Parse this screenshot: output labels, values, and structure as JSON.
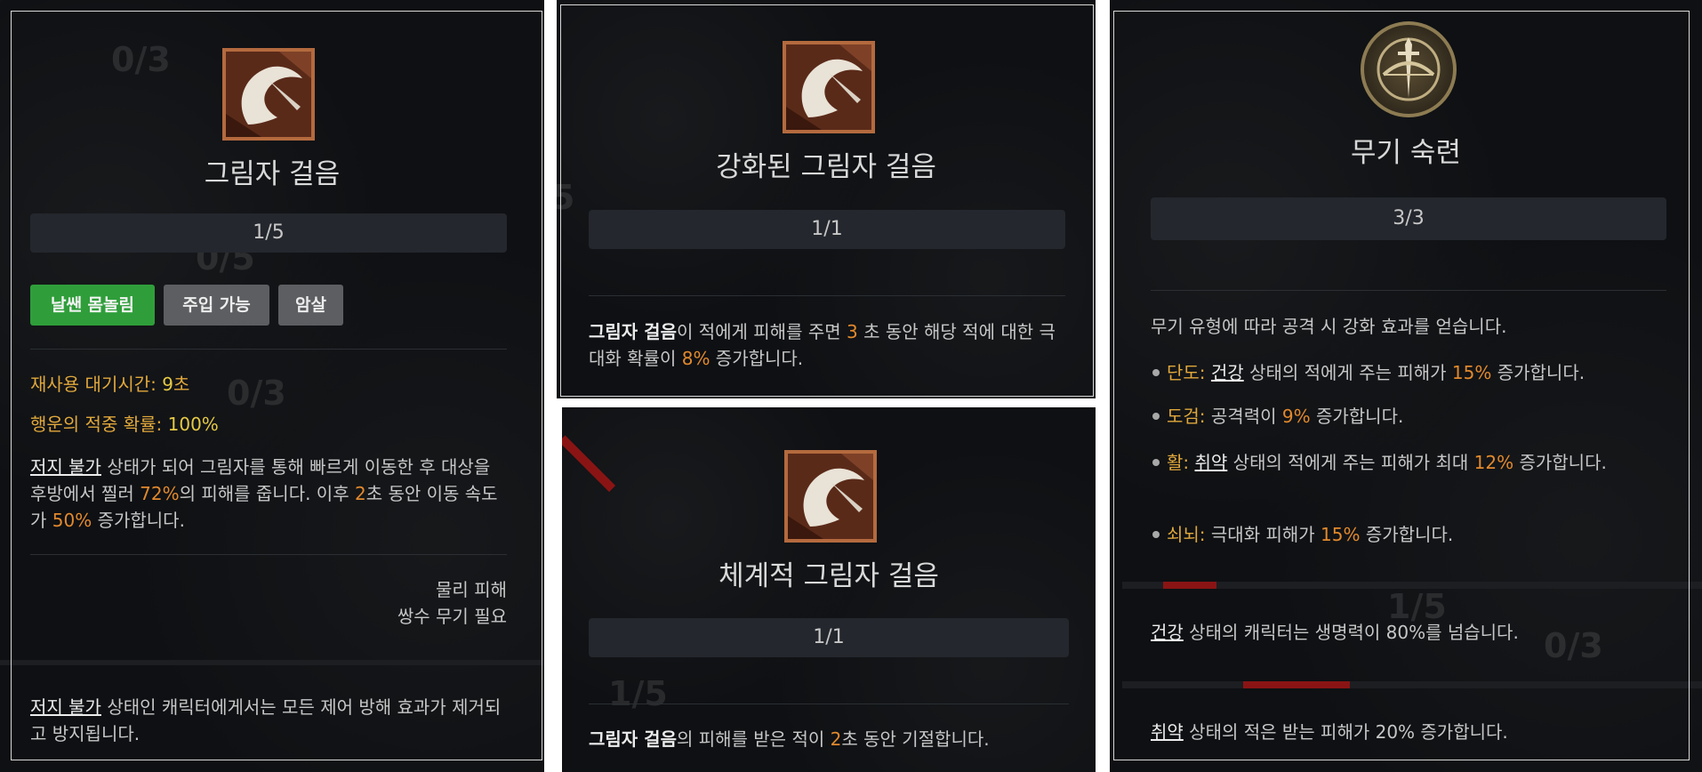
{
  "panel1": {
    "ghost_counts": [
      "0/3",
      "0/5",
      "0/3"
    ],
    "icon": "shadow-step-blade-icon",
    "title": "그림자 걸음",
    "rank": "1/5",
    "tags": [
      "날쌘 몸놀림",
      "주입 가능",
      "암살"
    ],
    "cooldown_label": "재사용 대기시간:",
    "cooldown_value": "9",
    "cooldown_unit": "초",
    "lucky_label": "행운의 적중 확률:",
    "lucky_value": "100%",
    "desc_term": "저지 불가",
    "desc_part1": " 상태가 되어 그림자를 통해 빠르게 이동한 후 대상을 후방에서 찔러 ",
    "desc_damage": "72%",
    "desc_part2": "의 피해를 줍니다. 이후 ",
    "desc_duration": "2",
    "desc_part3": "초 동안 이동 속도가 ",
    "desc_speed": "50%",
    "desc_part4": " 증가합니다.",
    "damage_type": "물리 피해",
    "requirement": "쌍수 무기 필요",
    "note_term": "저지 불가",
    "note_text": " 상태인 캐릭터에게서는 모든 제어 방해 효과가 제거되고 방지됩니다."
  },
  "panel2": {
    "icon": "shadow-step-blade-icon",
    "title": "강화된 그림자 걸음",
    "rank": "1/1",
    "desc_term": "그림자 걸음",
    "desc_part1": "이 적에게 피해를 주면 ",
    "desc_seconds": "3",
    "desc_part2": " 초 동안 해당 적에 대한 극대화 확률이 ",
    "desc_percent": "8%",
    "desc_part3": " 증가합니다."
  },
  "panel3": {
    "icon": "shadow-step-blade-icon",
    "title": "체계적 그림자 걸음",
    "rank": "1/1",
    "ghost_count": "1/5",
    "desc_term": "그림자 걸음",
    "desc_part1": "의 피해를 받은 적이 ",
    "desc_seconds": "2",
    "desc_part2": "초 동안 기절합니다."
  },
  "panel4": {
    "icon": "sword-crossbow-emblem-icon",
    "title": "무기 숙련",
    "rank": "3/3",
    "intro": "무기 유형에 따라 공격 시 강화 효과를 얻습니다.",
    "bullets": [
      {
        "weapon": "단도:",
        "term": "건강",
        "text1": " 상태의 적에게 주는 피해가 ",
        "value": "15%",
        "text2": " 증가합니다."
      },
      {
        "weapon": "도검:",
        "term": "",
        "text1": " 공격력이 ",
        "value": "9%",
        "text2": " 증가합니다."
      },
      {
        "weapon": "활:",
        "term": "취약",
        "text1": " 상태의 적에게 주는 피해가 최대 ",
        "value": "12%",
        "text2": " 증가합니다."
      },
      {
        "weapon": "쇠뇌:",
        "term": "",
        "text1": " 극대화 피해가 ",
        "value": "15%",
        "text2": " 증가합니다."
      }
    ],
    "ghost_counts": [
      "1/5",
      "0/3"
    ],
    "note1_term": "건강",
    "note1_text": " 상태의 캐릭터는 생명력이 80%를 넘습니다.",
    "note2_term": "취약",
    "note2_text": " 상태의 적은 받는 피해가 20% 증가합니다."
  },
  "colors": {
    "panel_bg": "#0e1013",
    "gold_label": "#e1a83c",
    "orange_value": "#e2892d",
    "green_tag": "#2f9e3a",
    "grey_tag": "#5c5e61"
  }
}
